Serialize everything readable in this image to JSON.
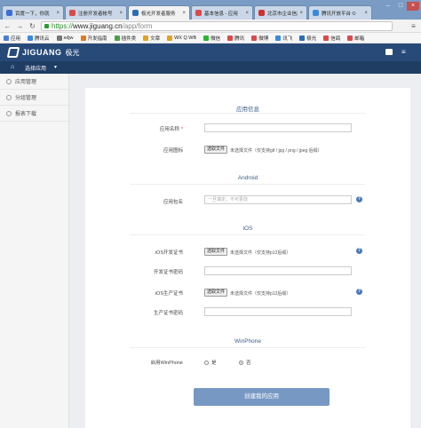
{
  "browser": {
    "tabs": [
      {
        "label": "百度一下，你就",
        "color": "#3a6fd8"
      },
      {
        "label": "注册开发者帐号",
        "color": "#d94a4a"
      },
      {
        "label": "极光开发者服务",
        "color": "#2a6db5"
      },
      {
        "label": "基本信息 - 应用",
        "color": "#d94a4a"
      },
      {
        "label": "北京市企业信用",
        "color": "#c33"
      },
      {
        "label": "腾讯开放平台 ©",
        "color": "#3a8adb"
      }
    ],
    "url_scheme": "https://",
    "url_host": "www.jiguang.cn",
    "url_path": "/app/form",
    "bookmarks": [
      {
        "label": "应用",
        "color": "#4a7dd8"
      },
      {
        "label": "腾讯云",
        "color": "#3a8adb"
      },
      {
        "label": "xdjw",
        "color": "#777"
      },
      {
        "label": "开发指南",
        "color": "#e07a1f"
      },
      {
        "label": "插件类",
        "color": "#4aa04a"
      },
      {
        "label": "文章",
        "color": "#e0a31f"
      },
      {
        "label": "WX Q WB",
        "color": "#e0a31f"
      },
      {
        "label": "微信",
        "color": "#2ab52a"
      },
      {
        "label": "腾讯",
        "color": "#d94a4a"
      },
      {
        "label": "微博",
        "color": "#d94a4a"
      },
      {
        "label": "讯飞",
        "color": "#3a8adb"
      },
      {
        "label": "极光",
        "color": "#2a6db5"
      },
      {
        "label": "信鸽",
        "color": "#d94a4a"
      },
      {
        "label": "邮箱",
        "color": "#d94a4a"
      }
    ]
  },
  "header": {
    "logo_en": "JIGUANG",
    "logo_cn": "极光",
    "app_select": "选择应用"
  },
  "sidebar": {
    "items": [
      {
        "label": "应用管理"
      },
      {
        "label": "分组管理"
      },
      {
        "label": "报表下载"
      }
    ]
  },
  "form": {
    "sections": {
      "app_info": "应用信息",
      "android": "Android",
      "ios": "iOS",
      "winphone": "WinPhone"
    },
    "app_name_label": "应用名称",
    "app_name_required": "*",
    "app_icon_label": "应用图标",
    "file_button": "选取文件",
    "app_icon_hint": "未选择文件（仅支持gif / jpg / png / jpeg 后缀）",
    "package_label": "应用包名",
    "package_placeholder": "一旦填定，不可更改",
    "ios_dev_cert_label": "iOS开发证书",
    "ios_dev_cert_hint": "未选择文件（仅支持p12后缀）",
    "dev_cert_pwd_label": "开发证书密码",
    "ios_prod_cert_label": "iOS生产证书",
    "ios_prod_cert_hint": "未选择文件（仅支持p12后缀）",
    "prod_cert_pwd_label": "生产证书密码",
    "winphone_label": "启用WinPhone",
    "radio_yes": "是",
    "radio_no": "否",
    "submit_label": "创建我的应用"
  }
}
